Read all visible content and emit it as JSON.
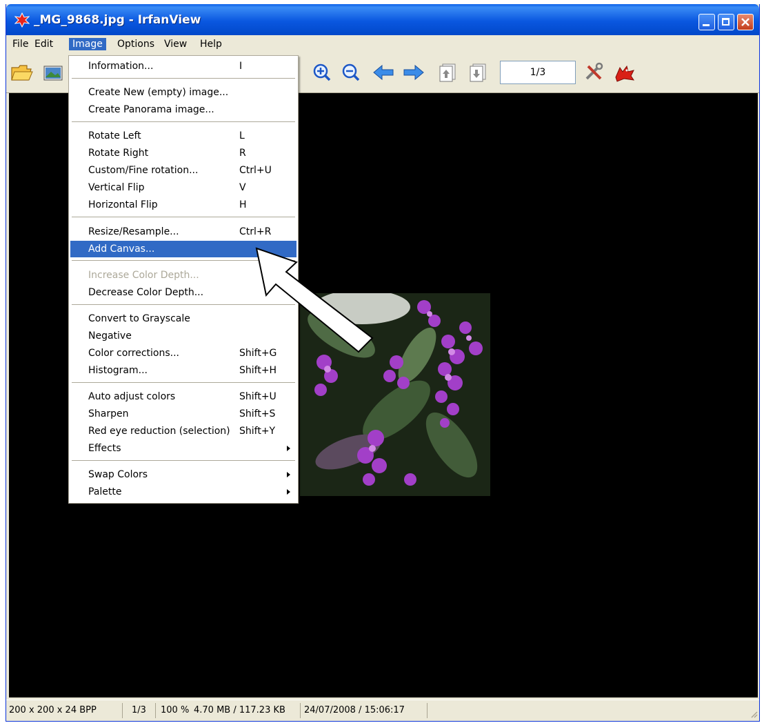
{
  "window": {
    "title": "_MG_9868.jpg - IrfanView"
  },
  "menubar": {
    "items": [
      "File",
      "Edit",
      "Image",
      "Options",
      "View",
      "Help"
    ],
    "active": "Image"
  },
  "toolbar": {
    "page_indicator": "1/3"
  },
  "image_menu": {
    "items": [
      {
        "label": "Information...",
        "shortcut": "I"
      },
      {
        "label": "Create New (empty) image...",
        "shortcut": ""
      },
      {
        "label": "Create Panorama image...",
        "shortcut": ""
      },
      {
        "label": "Rotate Left",
        "shortcut": "L"
      },
      {
        "label": "Rotate Right",
        "shortcut": "R"
      },
      {
        "label": "Custom/Fine rotation...",
        "shortcut": "Ctrl+U"
      },
      {
        "label": "Vertical Flip",
        "shortcut": "V"
      },
      {
        "label": "Horizontal Flip",
        "shortcut": "H"
      },
      {
        "label": "Resize/Resample...",
        "shortcut": "Ctrl+R"
      },
      {
        "label": "Add Canvas...",
        "shortcut": ""
      },
      {
        "label": "Increase Color Depth...",
        "shortcut": ""
      },
      {
        "label": "Decrease Color Depth...",
        "shortcut": ""
      },
      {
        "label": "Convert to Grayscale",
        "shortcut": ""
      },
      {
        "label": "Negative",
        "shortcut": ""
      },
      {
        "label": "Color corrections...",
        "shortcut": "Shift+G"
      },
      {
        "label": "Histogram...",
        "shortcut": "Shift+H"
      },
      {
        "label": "Auto adjust colors",
        "shortcut": "Shift+U"
      },
      {
        "label": "Sharpen",
        "shortcut": "Shift+S"
      },
      {
        "label": "Red eye reduction (selection)",
        "shortcut": "Shift+Y"
      },
      {
        "label": "Effects",
        "shortcut": ""
      },
      {
        "label": "Swap Colors",
        "shortcut": ""
      },
      {
        "label": "Palette",
        "shortcut": ""
      }
    ],
    "highlighted": "Add Canvas...",
    "disabled": [
      "Increase Color Depth..."
    ],
    "submenus": [
      "Effects",
      "Swap Colors",
      "Palette"
    ]
  },
  "statusbar": {
    "dimensions": "200 x 200 x 24 BPP",
    "page": "1/3",
    "zoom": "100 %",
    "size": "4.70 MB / 117.23 KB",
    "datetime": "24/07/2008 / 15:06:17"
  },
  "colors": {
    "menu_highlight": "#316ac5",
    "titlebar": "#0a57e0",
    "chrome": "#ece9d8"
  },
  "icons": [
    "open-folder-icon",
    "thumbnails-icon",
    "zoom-in-icon",
    "zoom-out-icon",
    "previous-arrow-icon",
    "next-arrow-icon",
    "first-page-icon",
    "last-page-icon",
    "settings-icon",
    "irfanview-cat-icon"
  ]
}
